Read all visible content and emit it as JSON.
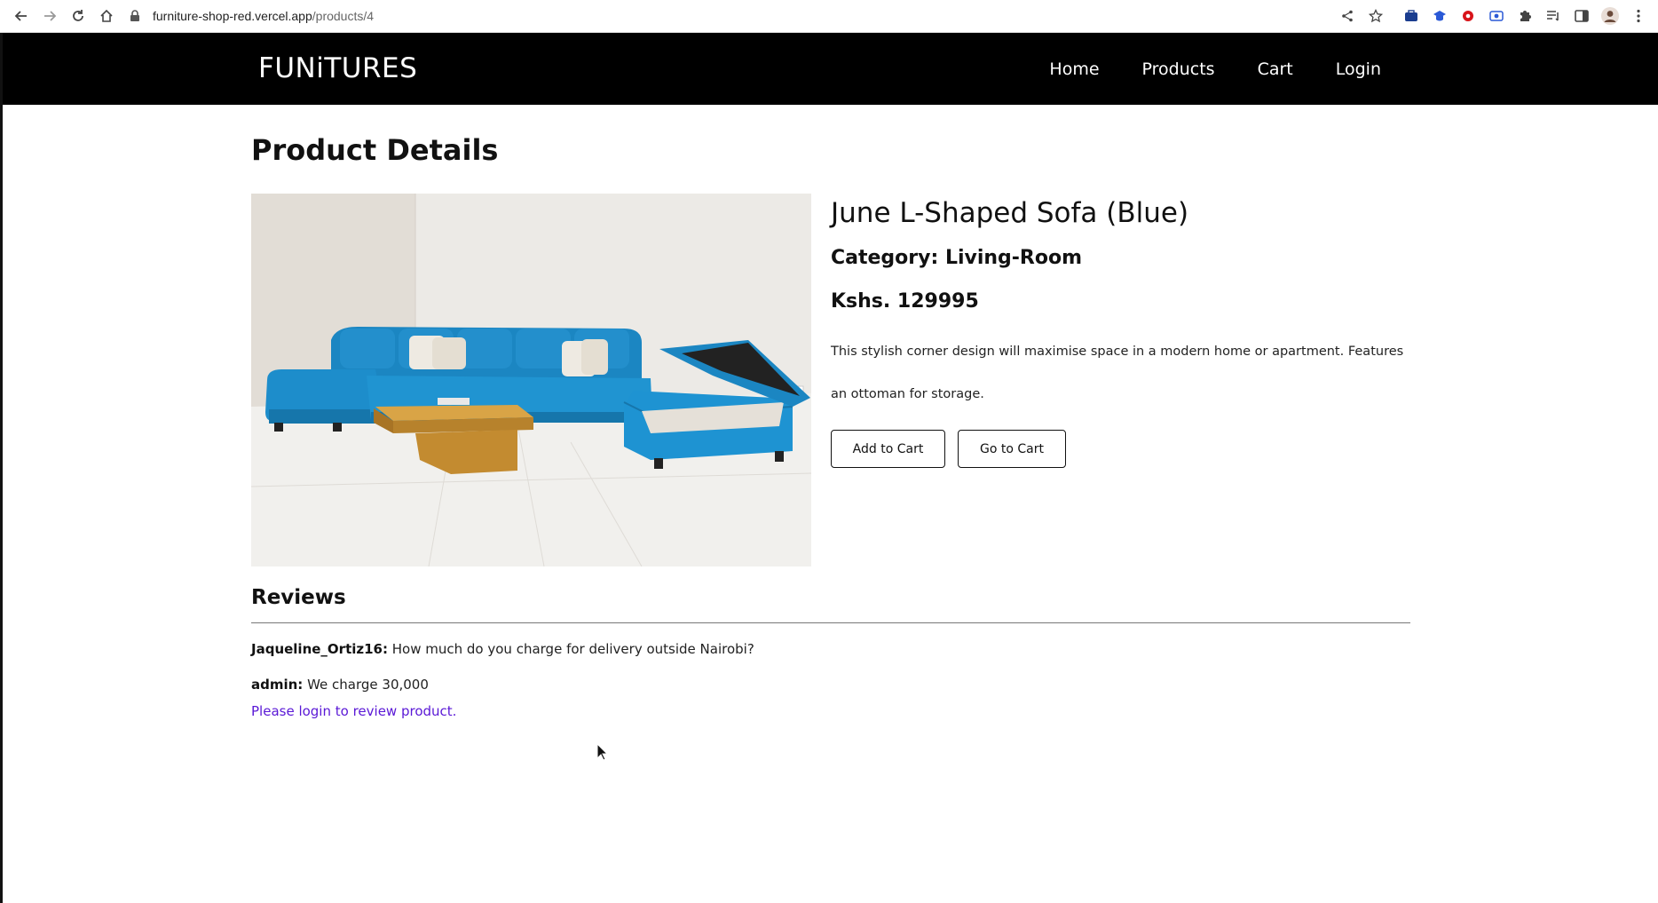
{
  "browser": {
    "url_host": "furniture-shop-red.vercel.app",
    "url_path": "/products/4"
  },
  "site": {
    "brand": "FUNiTURES",
    "nav": [
      {
        "label": "Home"
      },
      {
        "label": "Products"
      },
      {
        "label": "Cart"
      },
      {
        "label": "Login"
      }
    ]
  },
  "page": {
    "title": "Product Details"
  },
  "product": {
    "name": "June L-Shaped Sofa (Blue)",
    "category": "Category: Living-Room",
    "price": "Kshs. 129995",
    "description": "This stylish corner design will maximise space in a modern home or apartment. Features an ottoman for storage.",
    "add_to_cart_label": "Add to Cart",
    "go_to_cart_label": "Go to Cart",
    "image_colors": {
      "sofa": "#1e8fcb",
      "table": "#c8922e",
      "floor": "#ecebe8"
    }
  },
  "reviews": {
    "title": "Reviews",
    "items": [
      {
        "author": "Jaqueline_Ortiz16:",
        "text": "How much do you charge for delivery outside Nairobi?"
      },
      {
        "author": "admin:",
        "text": "We charge 30,000"
      }
    ],
    "login_prompt": "Please login to review product."
  }
}
